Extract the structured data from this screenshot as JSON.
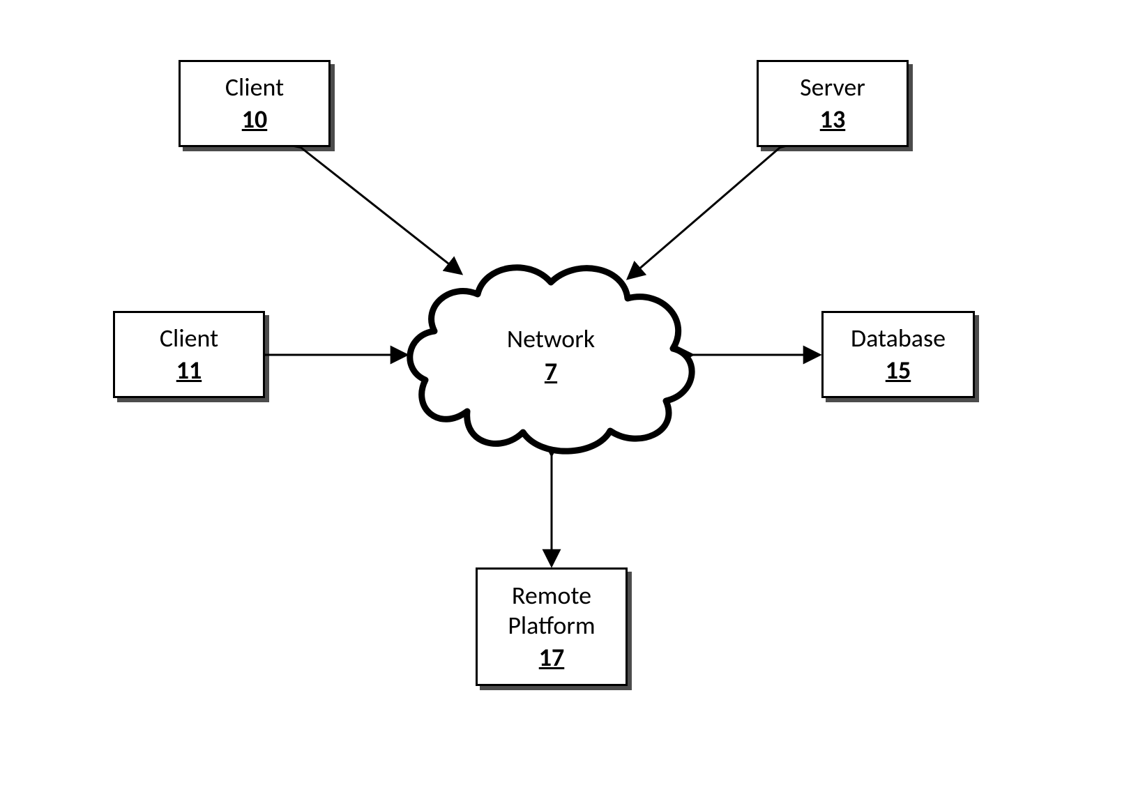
{
  "diagram": {
    "type": "network-topology",
    "nodes": {
      "client10": {
        "label": "Client",
        "id": "10"
      },
      "client11": {
        "label": "Client",
        "id": "11"
      },
      "server13": {
        "label": "Server",
        "id": "13"
      },
      "database15": {
        "label": "Database",
        "id": "15"
      },
      "remote17": {
        "label": "Remote\nPlatform",
        "id": "17"
      },
      "network7": {
        "label": "Network",
        "id": "7"
      }
    },
    "edges": [
      {
        "from": "client10",
        "to": "network7",
        "bidirectional": true
      },
      {
        "from": "client11",
        "to": "network7",
        "bidirectional": true
      },
      {
        "from": "server13",
        "to": "network7",
        "bidirectional": true
      },
      {
        "from": "database15",
        "to": "network7",
        "bidirectional": true
      },
      {
        "from": "remote17",
        "to": "network7",
        "bidirectional": true
      }
    ]
  }
}
